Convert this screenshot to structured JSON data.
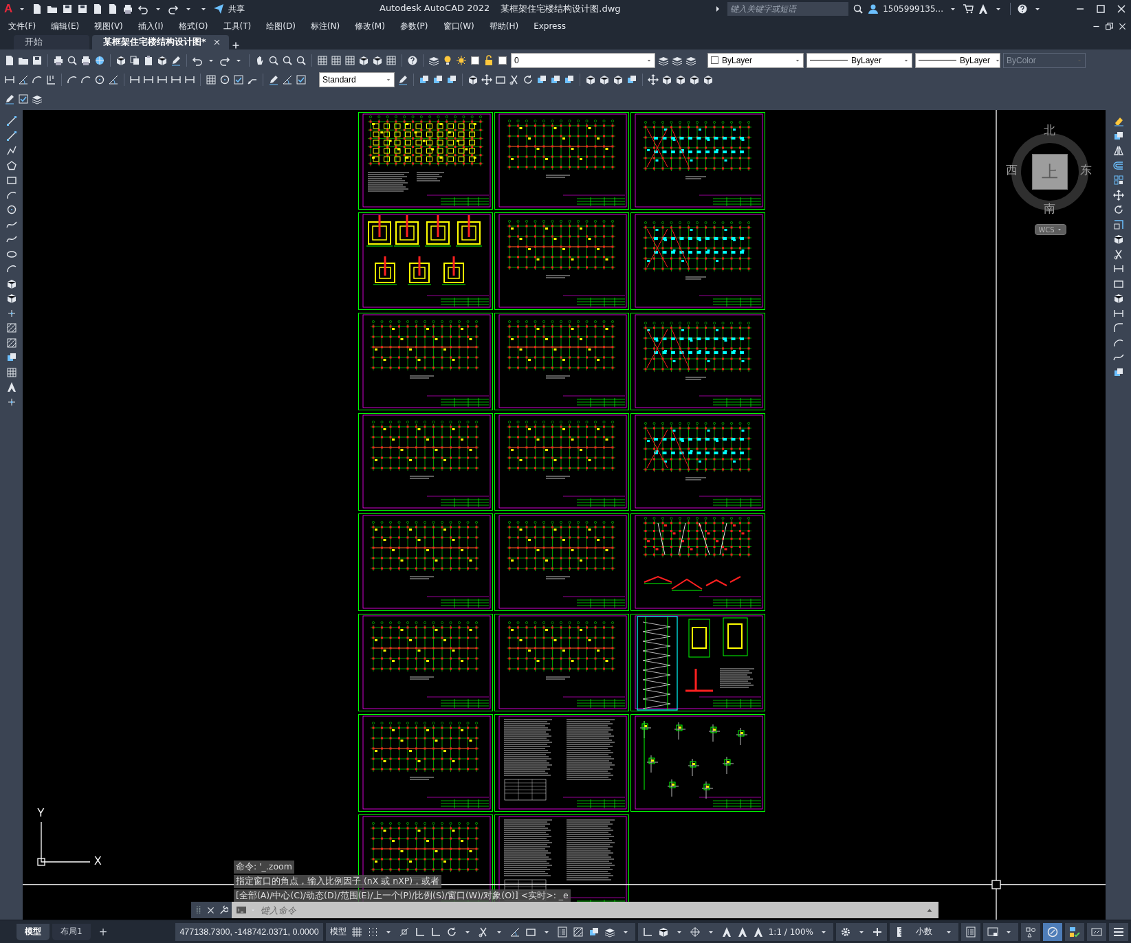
{
  "title_bar": {
    "logo": "A",
    "share": "共享",
    "app_title": "Autodesk AutoCAD 2022",
    "file_name": "某框架住宅楼结构设计图.dwg",
    "search": {
      "placeholder": "键入关键字或短语"
    },
    "user": "1505999135..."
  },
  "menu": [
    "文件(F)",
    "编辑(E)",
    "视图(V)",
    "插入(I)",
    "格式(O)",
    "工具(T)",
    "绘图(D)",
    "标注(N)",
    "修改(M)",
    "参数(P)",
    "窗口(W)",
    "帮助(H)",
    "Express"
  ],
  "tabs": [
    {
      "label": "开始",
      "selected": false
    },
    {
      "label": "某框架住宅楼结构设计图*",
      "selected": true
    }
  ],
  "toolbar": {
    "layer": "0",
    "color_control": "ByLayer",
    "linetype": "ByLayer",
    "lineweight": "ByLayer",
    "plot_style": {
      "value": "ByColor",
      "disabled": true
    },
    "text_style": "Standard"
  },
  "viewcube": {
    "north": "北",
    "south": "南",
    "east": "东",
    "west": "西",
    "face": "上",
    "ucs": "WCS"
  },
  "ucs_icon": {
    "x": "X",
    "y": "Y"
  },
  "sheets": [
    {
      "kind": "foundation_plan"
    },
    {
      "kind": "plan"
    },
    {
      "kind": "beam"
    },
    {
      "kind": "foundation_detail"
    },
    {
      "kind": "plan"
    },
    {
      "kind": "beam"
    },
    {
      "kind": "plan"
    },
    {
      "kind": "plan"
    },
    {
      "kind": "beam"
    },
    {
      "kind": "plan"
    },
    {
      "kind": "plan"
    },
    {
      "kind": "beam"
    },
    {
      "kind": "plan"
    },
    {
      "kind": "plan"
    },
    {
      "kind": "roof"
    },
    {
      "kind": "plan"
    },
    {
      "kind": "plan"
    },
    {
      "kind": "stair"
    },
    {
      "kind": "plan"
    },
    {
      "kind": "notes"
    },
    {
      "kind": "details"
    },
    {
      "kind": "plan"
    },
    {
      "kind": "notes"
    }
  ],
  "command_line": {
    "history": [
      "命令: '_.zoom",
      "指定窗口的角点，输入比例因子 (nX 或 nXP)，或者",
      "[全部(A)/中心(C)/动态(D)/范围(E)/上一个(P)/比例(S)/窗口(W)/对象(O)] <实时>: _e"
    ],
    "placeholder": "键入命令"
  },
  "layout_tabs": [
    {
      "label": "模型",
      "selected": true
    },
    {
      "label": "布局1",
      "selected": false
    }
  ],
  "add_layout": "+",
  "status_bar": {
    "coordinates": "477138.7300, -148742.0371, 0.0000",
    "space": "模型",
    "scale": "1:1 / 100%",
    "units": "小数"
  }
}
